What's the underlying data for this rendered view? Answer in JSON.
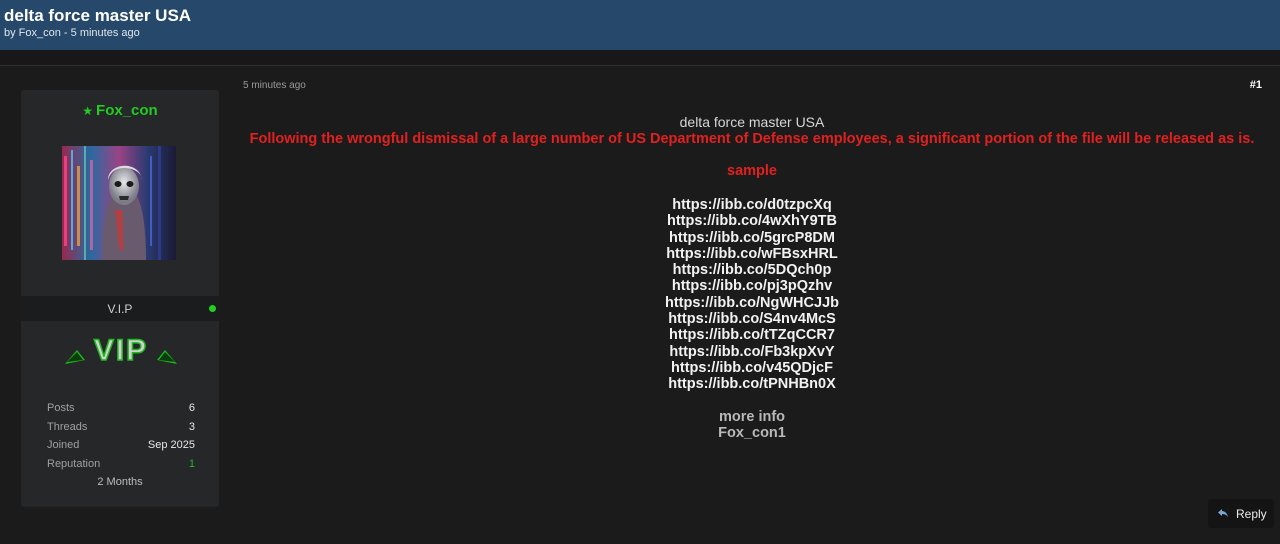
{
  "thread": {
    "title": "delta force master USA",
    "meta": "by Fox_con - 5 minutes ago"
  },
  "user": {
    "name": "Fox_con",
    "rank": "V.I.P",
    "badge_text": "VIP",
    "stats": [
      {
        "label": "Posts",
        "value": "6"
      },
      {
        "label": "Threads",
        "value": "3"
      },
      {
        "label": "Joined",
        "value": "Sep 2025"
      },
      {
        "label": "Reputation",
        "value": "1"
      }
    ],
    "membership": "2 Months"
  },
  "post": {
    "time": "5 minutes ago",
    "number": "#1",
    "title": "delta force master USA",
    "notice": "Following the wrongful dismissal of a large number of US Department of Defense employees, a significant portion of the file will be released as is.",
    "sample_label": "sample",
    "links": [
      "https://ibb.co/d0tzpcXq",
      "https://ibb.co/4wXhY9TB",
      "https://ibb.co/5grcP8DM",
      "https://ibb.co/wFBsxHRL",
      "https://ibb.co/5DQch0p",
      "https://ibb.co/pj3pQzhv",
      "https://ibb.co/NgWHCJJb",
      "https://ibb.co/S4nv4McS",
      "https://ibb.co/tTZqCCR7",
      "https://ibb.co/Fb3kpXvY",
      "https://ibb.co/v45QDjcF",
      "https://ibb.co/tPNHBn0X"
    ],
    "more_info": "more info",
    "contact": "Fox_con1"
  },
  "actions": {
    "reply_label": "Reply"
  },
  "colors": {
    "header": "#26486a",
    "username": "#22cc22",
    "notice": "#e22020",
    "online": "#1fd21f"
  },
  "icons": {
    "star": "star-icon",
    "reply": "reply-icon",
    "online": "online-status-icon"
  }
}
